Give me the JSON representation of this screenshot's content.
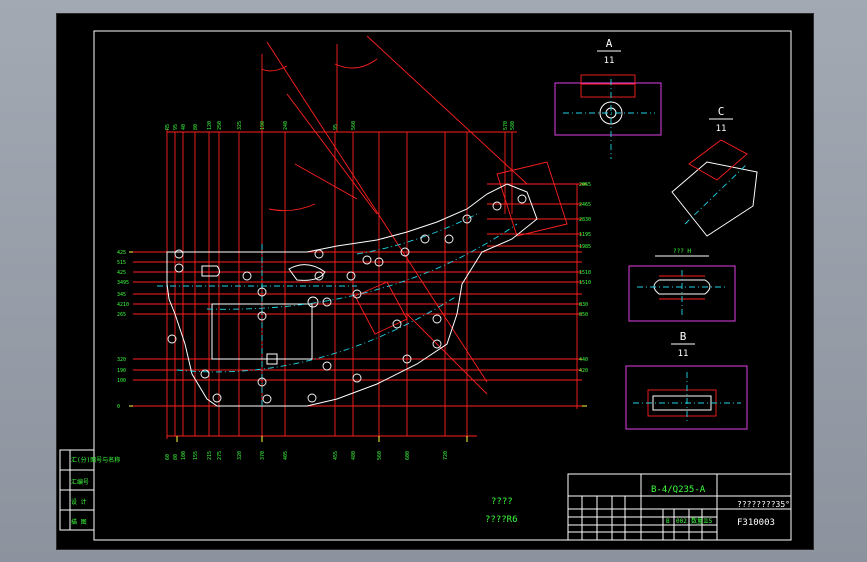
{
  "drawing": {
    "views": {
      "view_a": {
        "letter": "A",
        "scale": "11"
      },
      "view_c": {
        "letter": "C",
        "scale": "11"
      },
      "view_h": {
        "label": "??? H"
      },
      "view_b": {
        "letter": "B",
        "scale": "11"
      }
    },
    "notes": {
      "line1": "????",
      "line2": "????R6"
    },
    "left_labels": [
      "汇(分)图号与名称",
      "汇编号",
      "设 计",
      "描 图"
    ],
    "title_block": {
      "material": "B-4/Q235-A",
      "part_name": "????????35°",
      "drawing_no": "F310003",
      "scale_cells": [
        "B",
        "002",
        "数量1",
        "15"
      ]
    },
    "dim_labels_top": [
      "R5",
      "95",
      "40",
      "80",
      "120",
      "250",
      "325",
      "190",
      "240",
      "95",
      "560",
      "570",
      "580"
    ],
    "dim_labels_bottom": [
      "60",
      "80",
      "100",
      "155",
      "215",
      "275",
      "320",
      "370",
      "405",
      "455",
      "480",
      "560",
      "600",
      "720"
    ],
    "dim_labels_left": [
      "425",
      "515",
      "425",
      "3495",
      "345",
      "4210",
      "265",
      "320",
      "190",
      "100",
      "0"
    ],
    "dim_labels_right": [
      "2055",
      "2465",
      "2830",
      "1195",
      "1985",
      "1510",
      "1510",
      "830",
      "850",
      "440",
      "420"
    ]
  }
}
